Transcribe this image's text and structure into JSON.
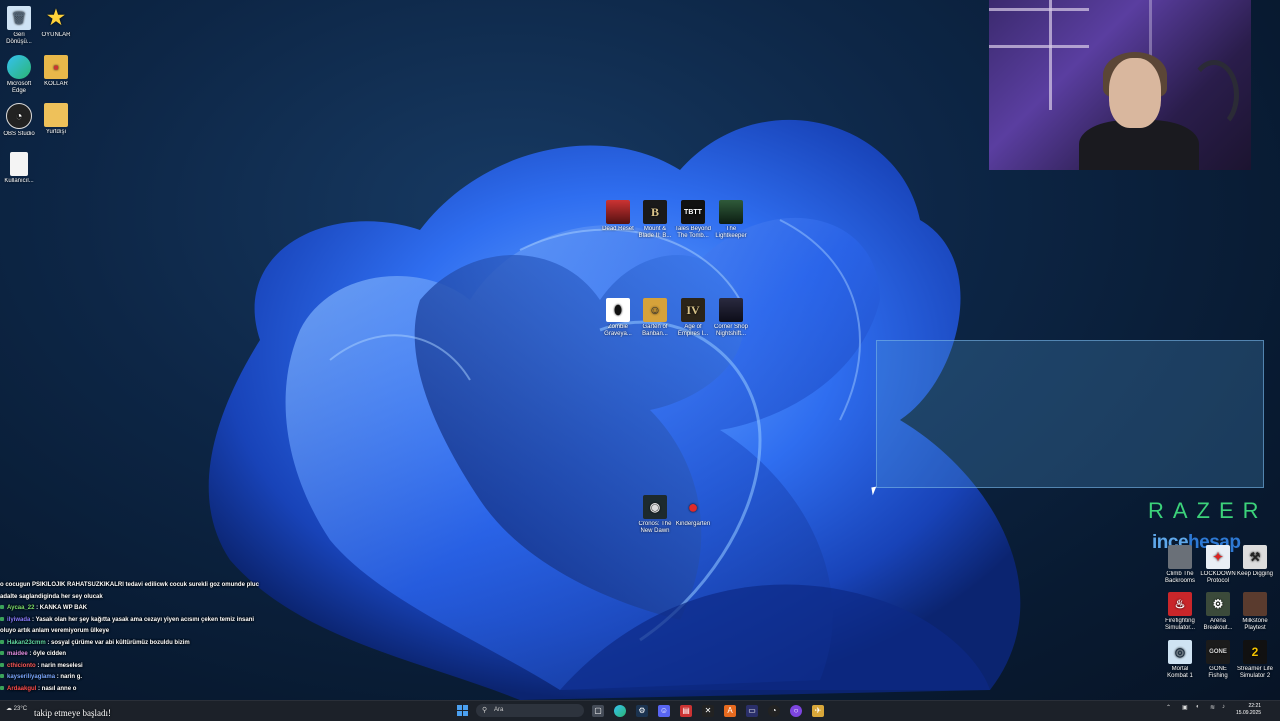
{
  "desktop_left": [
    {
      "label": "Geri Dönüşü...",
      "icon": "recycle-bin-icon"
    },
    {
      "label": "OYUNLAR",
      "icon": "star-folder-icon"
    },
    {
      "label": "Microsoft Edge",
      "icon": "edge-icon"
    },
    {
      "label": "KOLLAR",
      "icon": "folder-icon"
    },
    {
      "label": "OBS Studio",
      "icon": "obs-icon"
    },
    {
      "label": "Yurtdışı",
      "icon": "folder-icon"
    },
    {
      "label": "Kullanıcıl...",
      "icon": "document-icon"
    }
  ],
  "desktop_center_row1": [
    {
      "label": "Dead Reset",
      "glyph": ""
    },
    {
      "label": "Mount & Blade II: B...",
      "glyph": "B"
    },
    {
      "label": "Tales Beyond The Tomb...",
      "glyph": "TBTT"
    },
    {
      "label": "The Lightkeeper",
      "glyph": ""
    }
  ],
  "desktop_center_row2": [
    {
      "label": "Zombie Graveya...",
      "glyph": ""
    },
    {
      "label": "Garten of Banban...",
      "glyph": ""
    },
    {
      "label": "Age of Empires I...",
      "glyph": "IV"
    },
    {
      "label": "Corner Shop Nightshift...",
      "glyph": ""
    }
  ],
  "desktop_center_row3": [
    {
      "label": "Cronos: The New Dawn",
      "glyph": ""
    },
    {
      "label": "Kindergarten",
      "glyph": ""
    }
  ],
  "desktop_right": [
    {
      "label": "Climb The Backrooms"
    },
    {
      "label": "LOCKDOWN Protocol"
    },
    {
      "label": "Keep Digging"
    },
    {
      "label": "Firefighting Simulator..."
    },
    {
      "label": "Arena Breakout..."
    },
    {
      "label": "Milkstone Playtest"
    },
    {
      "label": "Mortal Kombat 1"
    },
    {
      "label": "GONE Fishing"
    },
    {
      "label": "Streamer Life Simulator 2"
    }
  ],
  "overlay": {
    "razer": "RAZER",
    "incehesap_a": "ince",
    "incehesap_b": "hesap"
  },
  "chat": [
    {
      "user": "",
      "text": "o cocugun PSIKILOJIK RAHATSUZKIKALRI tedavi edilicwk cocuk surekli goz omunde pluc",
      "color": "#ffffff"
    },
    {
      "user": "",
      "text": "adalte saglandiginda her sey olucak",
      "color": "#ffffff"
    },
    {
      "user": "Aycaa_22",
      "text": ": KANKA WP BAK",
      "color": "#7bdc6a"
    },
    {
      "user": "ilyiwada",
      "text": ": Yasak olan her şey kağıtta yasak ama cezayı yiyen acısını çeken temiz insani",
      "color": "#8a7cff"
    },
    {
      "user": "",
      "text": "oluyo artık anlam veremiyorum ülkeye",
      "color": "#ffffff"
    },
    {
      "user": "Hakan23cmm",
      "text": ": sosyal çürüme var abi kültürümüz bozuldu bizim",
      "color": "#5fd6a0"
    },
    {
      "user": "maidee",
      "text": ": öyle cidden",
      "color": "#e08de0"
    },
    {
      "user": "cthicionto",
      "text": ": narin meselesi",
      "color": "#ff5a5a"
    },
    {
      "user": "kayseriliyaglama",
      "text": ": narin g.",
      "color": "#7aa8ff"
    },
    {
      "user": "Ardaakgul",
      "text": ": nasıl anne o",
      "color": "#ff4d4d"
    }
  ],
  "follow_alert": "takip etmeye başladı!",
  "taskbar": {
    "weather": "23°C",
    "search_placeholder": "Ara",
    "time": "22:21",
    "date": "15.09.2025"
  },
  "colors": {
    "accent": "#1f6fe8",
    "razer_green": "#3cd27a",
    "incehesap_blue": "#2e79d4"
  }
}
